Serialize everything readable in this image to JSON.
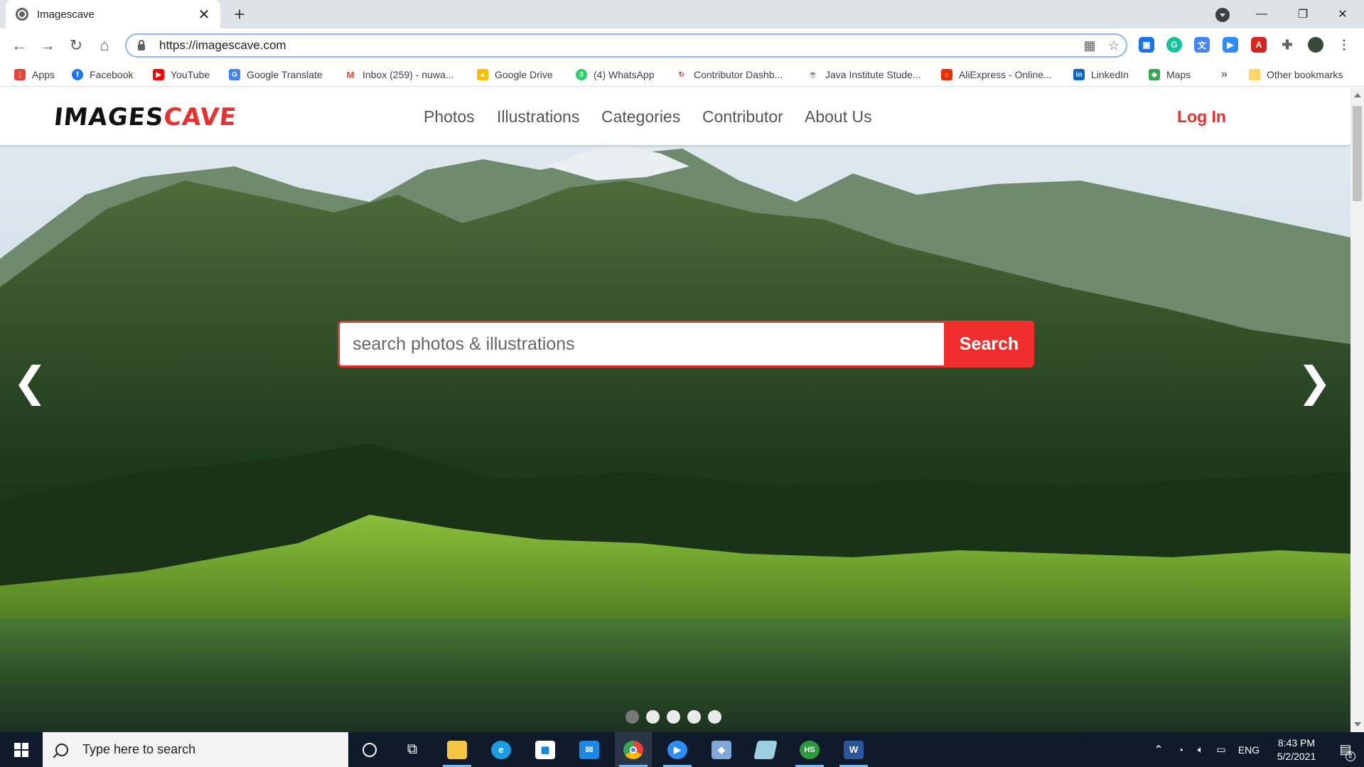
{
  "browser": {
    "tab_title": "Imagescave",
    "url": "https://imagescave.com"
  },
  "bookmarks": [
    {
      "label": "Apps",
      "icon": "apps-grid-icon",
      "color": "#ea4335"
    },
    {
      "label": "Facebook",
      "icon": "facebook-icon",
      "color": "#1877f2"
    },
    {
      "label": "YouTube",
      "icon": "youtube-icon",
      "color": "#ff0000"
    },
    {
      "label": "Google Translate",
      "icon": "google-translate-icon",
      "color": "#4285f4"
    },
    {
      "label": "Inbox (259) - nuwa...",
      "icon": "gmail-icon",
      "color": "#ea4335"
    },
    {
      "label": "Google Drive",
      "icon": "google-drive-icon",
      "color": "#34a853"
    },
    {
      "label": "(4) WhatsApp",
      "icon": "whatsapp-icon",
      "color": "#25d366"
    },
    {
      "label": "Contributor Dashb...",
      "icon": "contributor-icon",
      "color": "#e8302f"
    },
    {
      "label": "Java Institute Stude...",
      "icon": "java-institute-icon",
      "color": "#c0392b"
    },
    {
      "label": "AliExpress - Online...",
      "icon": "aliexpress-icon",
      "color": "#e62e04"
    },
    {
      "label": "LinkedIn",
      "icon": "linkedin-icon",
      "color": "#0a66c2"
    },
    {
      "label": "Maps",
      "icon": "google-maps-icon",
      "color": "#34a853"
    }
  ],
  "bookmarks_overflow": "»",
  "other_bookmarks": "Other bookmarks",
  "site": {
    "logo_part1": "IMAGES",
    "logo_part2": "CAVE",
    "nav": [
      "Photos",
      "Illustrations",
      "Categories",
      "Contributor",
      "About Us"
    ],
    "login": "Log In"
  },
  "hero": {
    "search_placeholder": "search photos & illustrations",
    "search_button": "Search",
    "prev_arrow": "❮",
    "next_arrow": "❯",
    "slide_count": 5,
    "active_slide": 1
  },
  "taskbar": {
    "search_placeholder": "Type here to search",
    "apps": [
      "cortana",
      "task-view",
      "file-explorer",
      "edge",
      "microsoft-store",
      "mail",
      "chrome",
      "zoom",
      "virtualbox",
      "notepad",
      "hotspot-shield",
      "word"
    ],
    "language": "ENG",
    "time": "8:43 PM",
    "date": "5/2/2021",
    "notification_count": "2"
  },
  "colors": {
    "brand_red": "#e8302f",
    "omnibox_focus": "#8ab4f8",
    "taskbar": "#0f1a2a"
  }
}
